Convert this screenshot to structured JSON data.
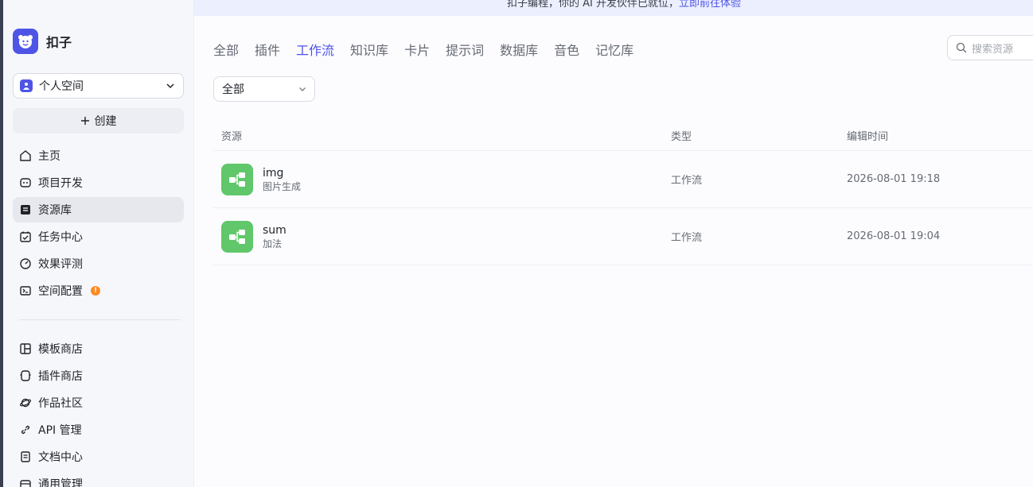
{
  "banner": {
    "text": "扣子编程，你的 AI 开发伙伴已就位，",
    "link": "立即前往体验"
  },
  "brand": {
    "name": "扣子",
    "accent": "#4e55e6"
  },
  "space": {
    "label": "个人空间"
  },
  "create": {
    "label": "创建"
  },
  "nav_top": [
    {
      "label": "主页",
      "icon": "home-icon"
    },
    {
      "label": "项目开发",
      "icon": "project-icon"
    },
    {
      "label": "资源库",
      "icon": "library-icon",
      "active": true
    },
    {
      "label": "任务中心",
      "icon": "task-icon"
    },
    {
      "label": "效果评测",
      "icon": "gauge-icon"
    },
    {
      "label": "空间配置",
      "icon": "terminal-icon",
      "badge": "!"
    }
  ],
  "nav_bottom": [
    {
      "label": "模板商店",
      "icon": "template-icon"
    },
    {
      "label": "插件商店",
      "icon": "plugin-icon"
    },
    {
      "label": "作品社区",
      "icon": "planet-icon"
    },
    {
      "label": "API 管理",
      "icon": "link-icon"
    },
    {
      "label": "文档中心",
      "icon": "doc-icon"
    },
    {
      "label": "通用管理",
      "icon": "box-icon"
    }
  ],
  "tabs": [
    "全部",
    "插件",
    "工作流",
    "知识库",
    "卡片",
    "提示词",
    "数据库",
    "音色",
    "记忆库"
  ],
  "active_tab": "工作流",
  "search": {
    "placeholder": "搜索资源"
  },
  "filter": {
    "value": "全部"
  },
  "table": {
    "headers": {
      "resource": "资源",
      "type": "类型",
      "time": "编辑时间"
    },
    "rows": [
      {
        "name": "img",
        "desc": "图片生成",
        "type": "工作流",
        "time": "2026-08-01 19:18"
      },
      {
        "name": "sum",
        "desc": "加法",
        "type": "工作流",
        "time": "2026-08-01 19:04"
      }
    ]
  },
  "colors": {
    "workflow_icon_bg": "#60c76a",
    "active_tab": "#4d53e8",
    "warning": "#ff8a1f"
  }
}
